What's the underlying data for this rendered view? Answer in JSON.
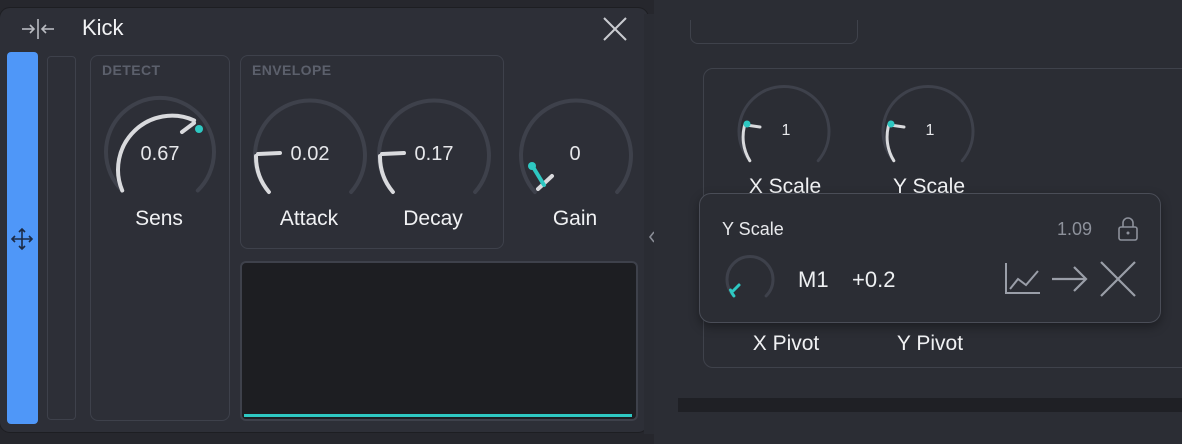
{
  "colors": {
    "accent": "#2ec8c2",
    "side_bar": "#4f97f8",
    "panel": "#2d2f37",
    "arc": "#d9dadd",
    "track": "#3e414b"
  },
  "module": {
    "title": "Kick",
    "icons": {
      "collapse": "collapse-arrows-icon",
      "close": "close-icon",
      "move": "move-arrows-icon"
    }
  },
  "detect": {
    "title": "DETECT",
    "sens": {
      "label": "Sens",
      "value": "0.67"
    }
  },
  "envelope": {
    "title": "ENVELOPE",
    "attack": {
      "label": "Attack",
      "value": "0.02"
    },
    "decay": {
      "label": "Decay",
      "value": "0.17"
    }
  },
  "gain": {
    "label": "Gain",
    "value": "0"
  },
  "transform": {
    "x_scale": {
      "label": "X Scale",
      "value": "1"
    },
    "y_scale": {
      "label": "Y Scale",
      "value": "1"
    },
    "x_pivot": {
      "label": "X Pivot"
    },
    "y_pivot": {
      "label": "Y Pivot"
    }
  },
  "popup": {
    "title": "Y Scale",
    "value": "1.09",
    "source": "M1",
    "amount": "+0.2",
    "icons": {
      "lock": "lock-icon",
      "curve": "curve-graph-icon",
      "route": "arrow-right-icon",
      "remove": "close-icon"
    }
  }
}
